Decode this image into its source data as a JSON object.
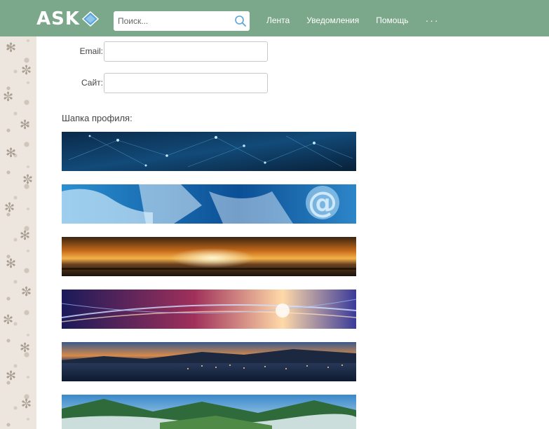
{
  "header": {
    "logo_text": "ASK",
    "search": {
      "placeholder": "Поиск...",
      "value": ""
    },
    "nav": [
      {
        "label": "Лента"
      },
      {
        "label": "Уведомления"
      },
      {
        "label": "Помощь"
      }
    ],
    "more_label": "···"
  },
  "form": {
    "email_label": "Email:",
    "email_value": "",
    "site_label": "Сайт:",
    "site_value": ""
  },
  "profile_header": {
    "title": "Шапка профиля:",
    "options": [
      {
        "name": "network-nodes"
      },
      {
        "name": "globe-at-sign"
      },
      {
        "name": "sunset-sea"
      },
      {
        "name": "light-rays"
      },
      {
        "name": "city-evening"
      },
      {
        "name": "mountain-valley"
      }
    ]
  },
  "colors": {
    "header_bg": "#7ba78a",
    "logo_accent": "#5aa6d8"
  }
}
